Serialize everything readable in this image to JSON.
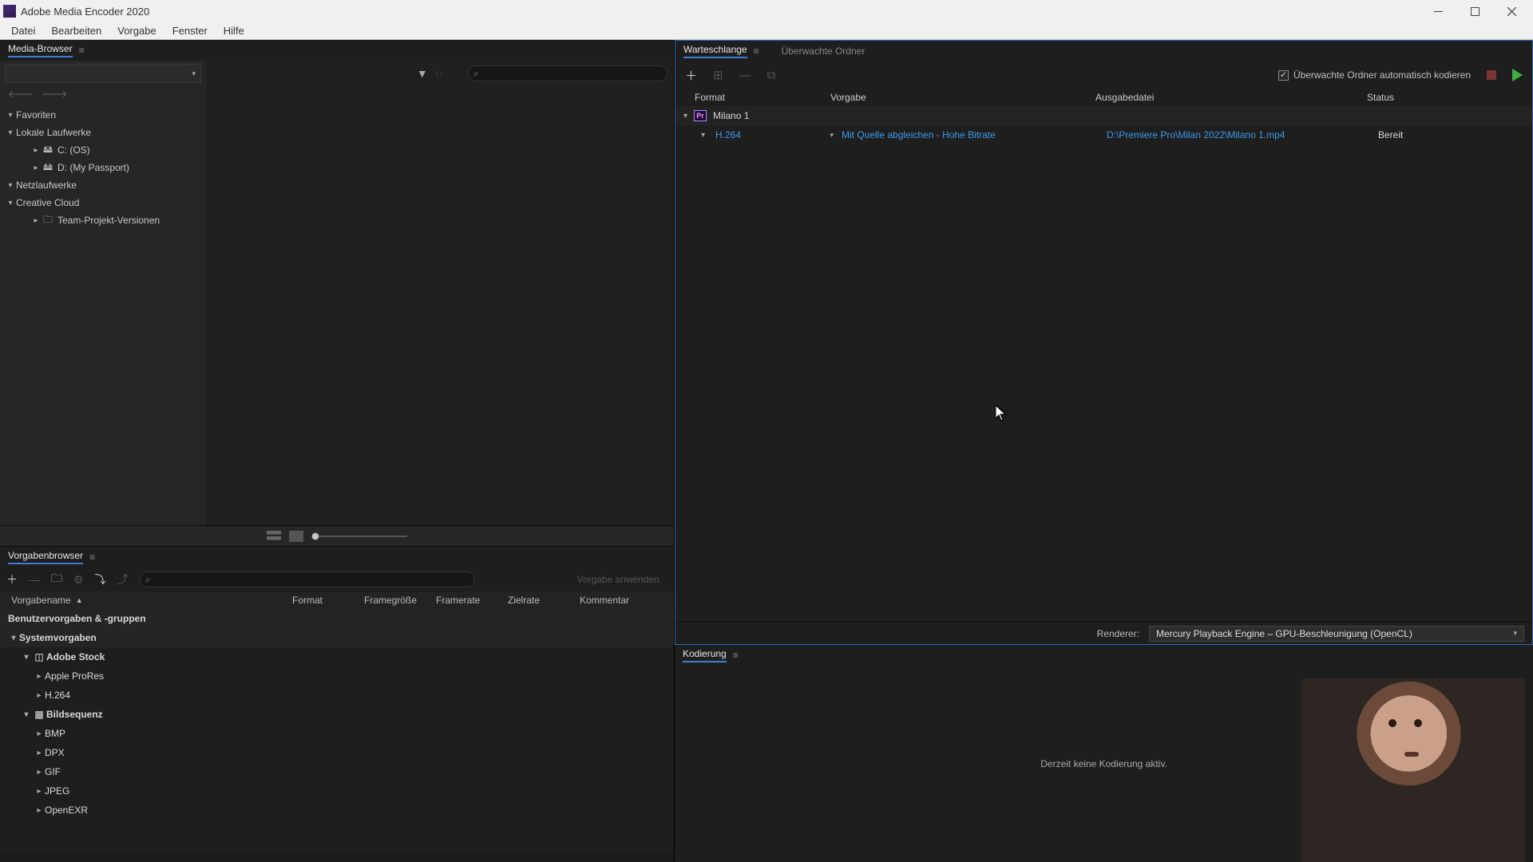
{
  "app": {
    "title": "Adobe Media Encoder 2020"
  },
  "menu": {
    "file": "Datei",
    "edit": "Bearbeiten",
    "preset": "Vorgabe",
    "window": "Fenster",
    "help": "Hilfe"
  },
  "media_browser": {
    "title": "Media-Browser",
    "tree": {
      "favorites": "Favoriten",
      "local_drives": "Lokale Laufwerke",
      "drive_c": "C: (OS)",
      "drive_d": "D: (My Passport)",
      "network_drives": "Netzlaufwerke",
      "creative_cloud": "Creative Cloud",
      "team_versions": "Team-Projekt-Versionen"
    }
  },
  "preset_browser": {
    "title": "Vorgabenbrowser",
    "apply_btn": "Vorgabe anwenden",
    "headers": {
      "name": "Vorgabename",
      "format": "Format",
      "framesize": "Framegröße",
      "framerate": "Framerate",
      "target": "Zielrate",
      "comment": "Kommentar"
    },
    "groups": {
      "user": "Benutzervorgaben & -gruppen",
      "system": "Systemvorgaben",
      "adobe_stock": "Adobe Stock",
      "apple_prores": "Apple ProRes",
      "h264": "H.264",
      "image_sequence": "Bildsequenz",
      "bmp": "BMP",
      "dpx": "DPX",
      "gif": "GIF",
      "jpeg": "JPEG",
      "openexr": "OpenEXR"
    }
  },
  "queue": {
    "tab_queue": "Warteschlange",
    "tab_watch": "Überwachte Ordner",
    "auto_encode": "Überwachte Ordner automatisch kodieren",
    "headers": {
      "format": "Format",
      "preset": "Vorgabe",
      "output": "Ausgabedatei",
      "status": "Status"
    },
    "source": {
      "name": "Milano 1",
      "app_badge": "Pr"
    },
    "output": {
      "format": "H.264",
      "preset": "Mit Quelle abgleichen - Hohe Bitrate",
      "file": "D:\\Premiere Pro\\Milan 2022\\Milano 1.mp4",
      "status": "Bereit"
    },
    "renderer_label": "Renderer:",
    "renderer_value": "Mercury Playback Engine – GPU-Beschleunigung (OpenCL)"
  },
  "encoding": {
    "title": "Kodierung",
    "idle_text": "Derzeit keine Kodierung aktiv."
  }
}
